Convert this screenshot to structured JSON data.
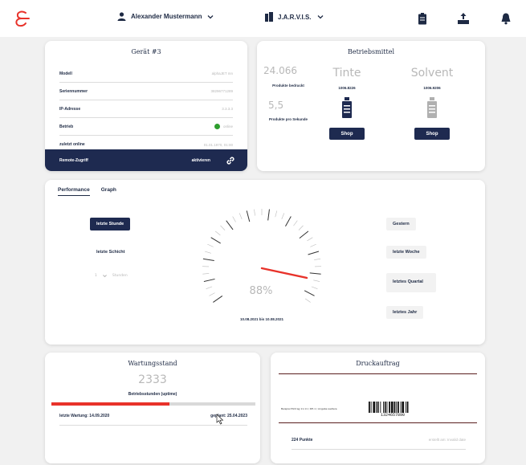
{
  "colors": {
    "brand_red": "#e8322a",
    "navy": "#1e2a50",
    "online_green": "#2e9e2e"
  },
  "topbar": {
    "user_name": "Alexander Mustermann",
    "machine_name": "J.A.R.V.I.S.",
    "icons": [
      "logo-icon",
      "user-icon",
      "printer-icon",
      "chevron-down-icon",
      "clipboard-icon",
      "upload-icon",
      "bell-icon"
    ]
  },
  "device": {
    "title": "Gerät #3",
    "rows": [
      {
        "label": "Modell",
        "value": "alphaJET mn"
      },
      {
        "label": "Seriennummer",
        "value": "38296771289"
      },
      {
        "label": "IP-Adresse",
        "value": "3.3.3.3"
      },
      {
        "label": "Betrieb",
        "value": "online"
      },
      {
        "label": "zuletzt online",
        "value": "01.01.1970, 01:00"
      }
    ],
    "remote_label": "Remote-Zugriff",
    "remote_action": "aktivieren"
  },
  "supplies": {
    "title": "Betriebsmittel",
    "printed_count": "24.066",
    "printed_label": "Produkte bedruckt",
    "rate": "5,5",
    "rate_label": "Produkte pro Sekunde",
    "ink_name": "Tinte",
    "ink_value": "1006.8226",
    "solvent_name": "Solvent",
    "solvent_value": "1006.9206",
    "shop_label": "Shop"
  },
  "performance": {
    "tabs": [
      {
        "label": "Performance",
        "active": true
      },
      {
        "label": "Graph",
        "active": false
      }
    ],
    "left_buttons": [
      "letzte Stunde",
      "letzte Schicht"
    ],
    "hours_value": "1",
    "hours_label": "Stunden",
    "right_buttons": [
      "Gestern",
      "letzte Woche",
      "letztes Quartal",
      "letztes Jahr"
    ],
    "gauge_percent": "88%",
    "gauge_value": 0.88,
    "date_range": "10.08.2021 bis 10.08.2021"
  },
  "maintenance": {
    "title": "Wartungsstand",
    "hours": "2333",
    "hours_label": "Betriebsstunden (uptime)",
    "progress": 0.58,
    "last_label": "letzte Wartung: 14.09.2020",
    "planned_label": "geplant: 25.04.2023"
  },
  "print_job": {
    "title": "Druckauftrag",
    "label_text": "Beispiel Eintrag 11.11 / DE-1 / Angabe weitere",
    "barcode_number": "1324657890",
    "points_label": "224 Punkte",
    "created_label": "erstellt am: Invalid date"
  }
}
